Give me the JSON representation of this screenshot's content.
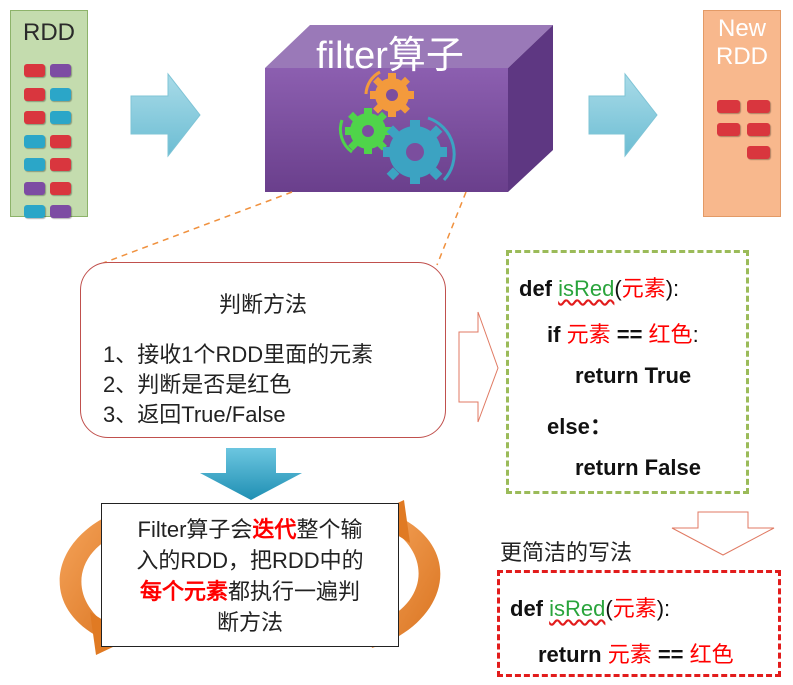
{
  "rdd": {
    "title": "RDD",
    "cells": [
      [
        "red",
        "purple"
      ],
      [
        "red",
        "blue"
      ],
      [
        "red",
        "blue"
      ],
      [
        "blue",
        "red"
      ],
      [
        "blue",
        "red"
      ],
      [
        "purple",
        "red"
      ],
      [
        "blue",
        "purple"
      ]
    ]
  },
  "filter_block": {
    "label": "filter算子"
  },
  "new_rdd": {
    "title_line1": "New",
    "title_line2": "RDD",
    "cells": [
      [
        "red",
        "red"
      ],
      [
        "red",
        "red"
      ],
      [
        "",
        "red"
      ]
    ]
  },
  "judge": {
    "title": "判断方法",
    "steps": [
      "1、接收1个RDD里面的元素",
      "2、判断是否是红色",
      "3、返回True/False"
    ]
  },
  "iterate": {
    "t1": "Filter算子会",
    "t2": "迭代",
    "t3": "整个输",
    "t4": "入的RDD，把RDD中的",
    "t5": "每个元素",
    "t6": "都执行一遍判",
    "t7": "断方法"
  },
  "code_full": {
    "def": "def",
    "fn": "isRed",
    "open": "(",
    "param": "元素",
    "close": "):",
    "if": "if",
    "eq": "==",
    "color": "红色",
    "colon": ":",
    "ret_true": "return True",
    "else": "else：",
    "ret_false": "return False"
  },
  "simpler_label": "更简洁的写法",
  "code_short": {
    "def": "def",
    "fn": "isRed",
    "open": "(",
    "param": "元素",
    "close": "):",
    "ret": "return",
    "eq": "==",
    "color": "红色"
  },
  "colors": {
    "red_cell": "#d9363e",
    "blue_cell": "#2ba6c8",
    "purple_cell": "#7d4ca3",
    "cube": "#7b4e9e",
    "arrow": "#8ccfe0"
  }
}
